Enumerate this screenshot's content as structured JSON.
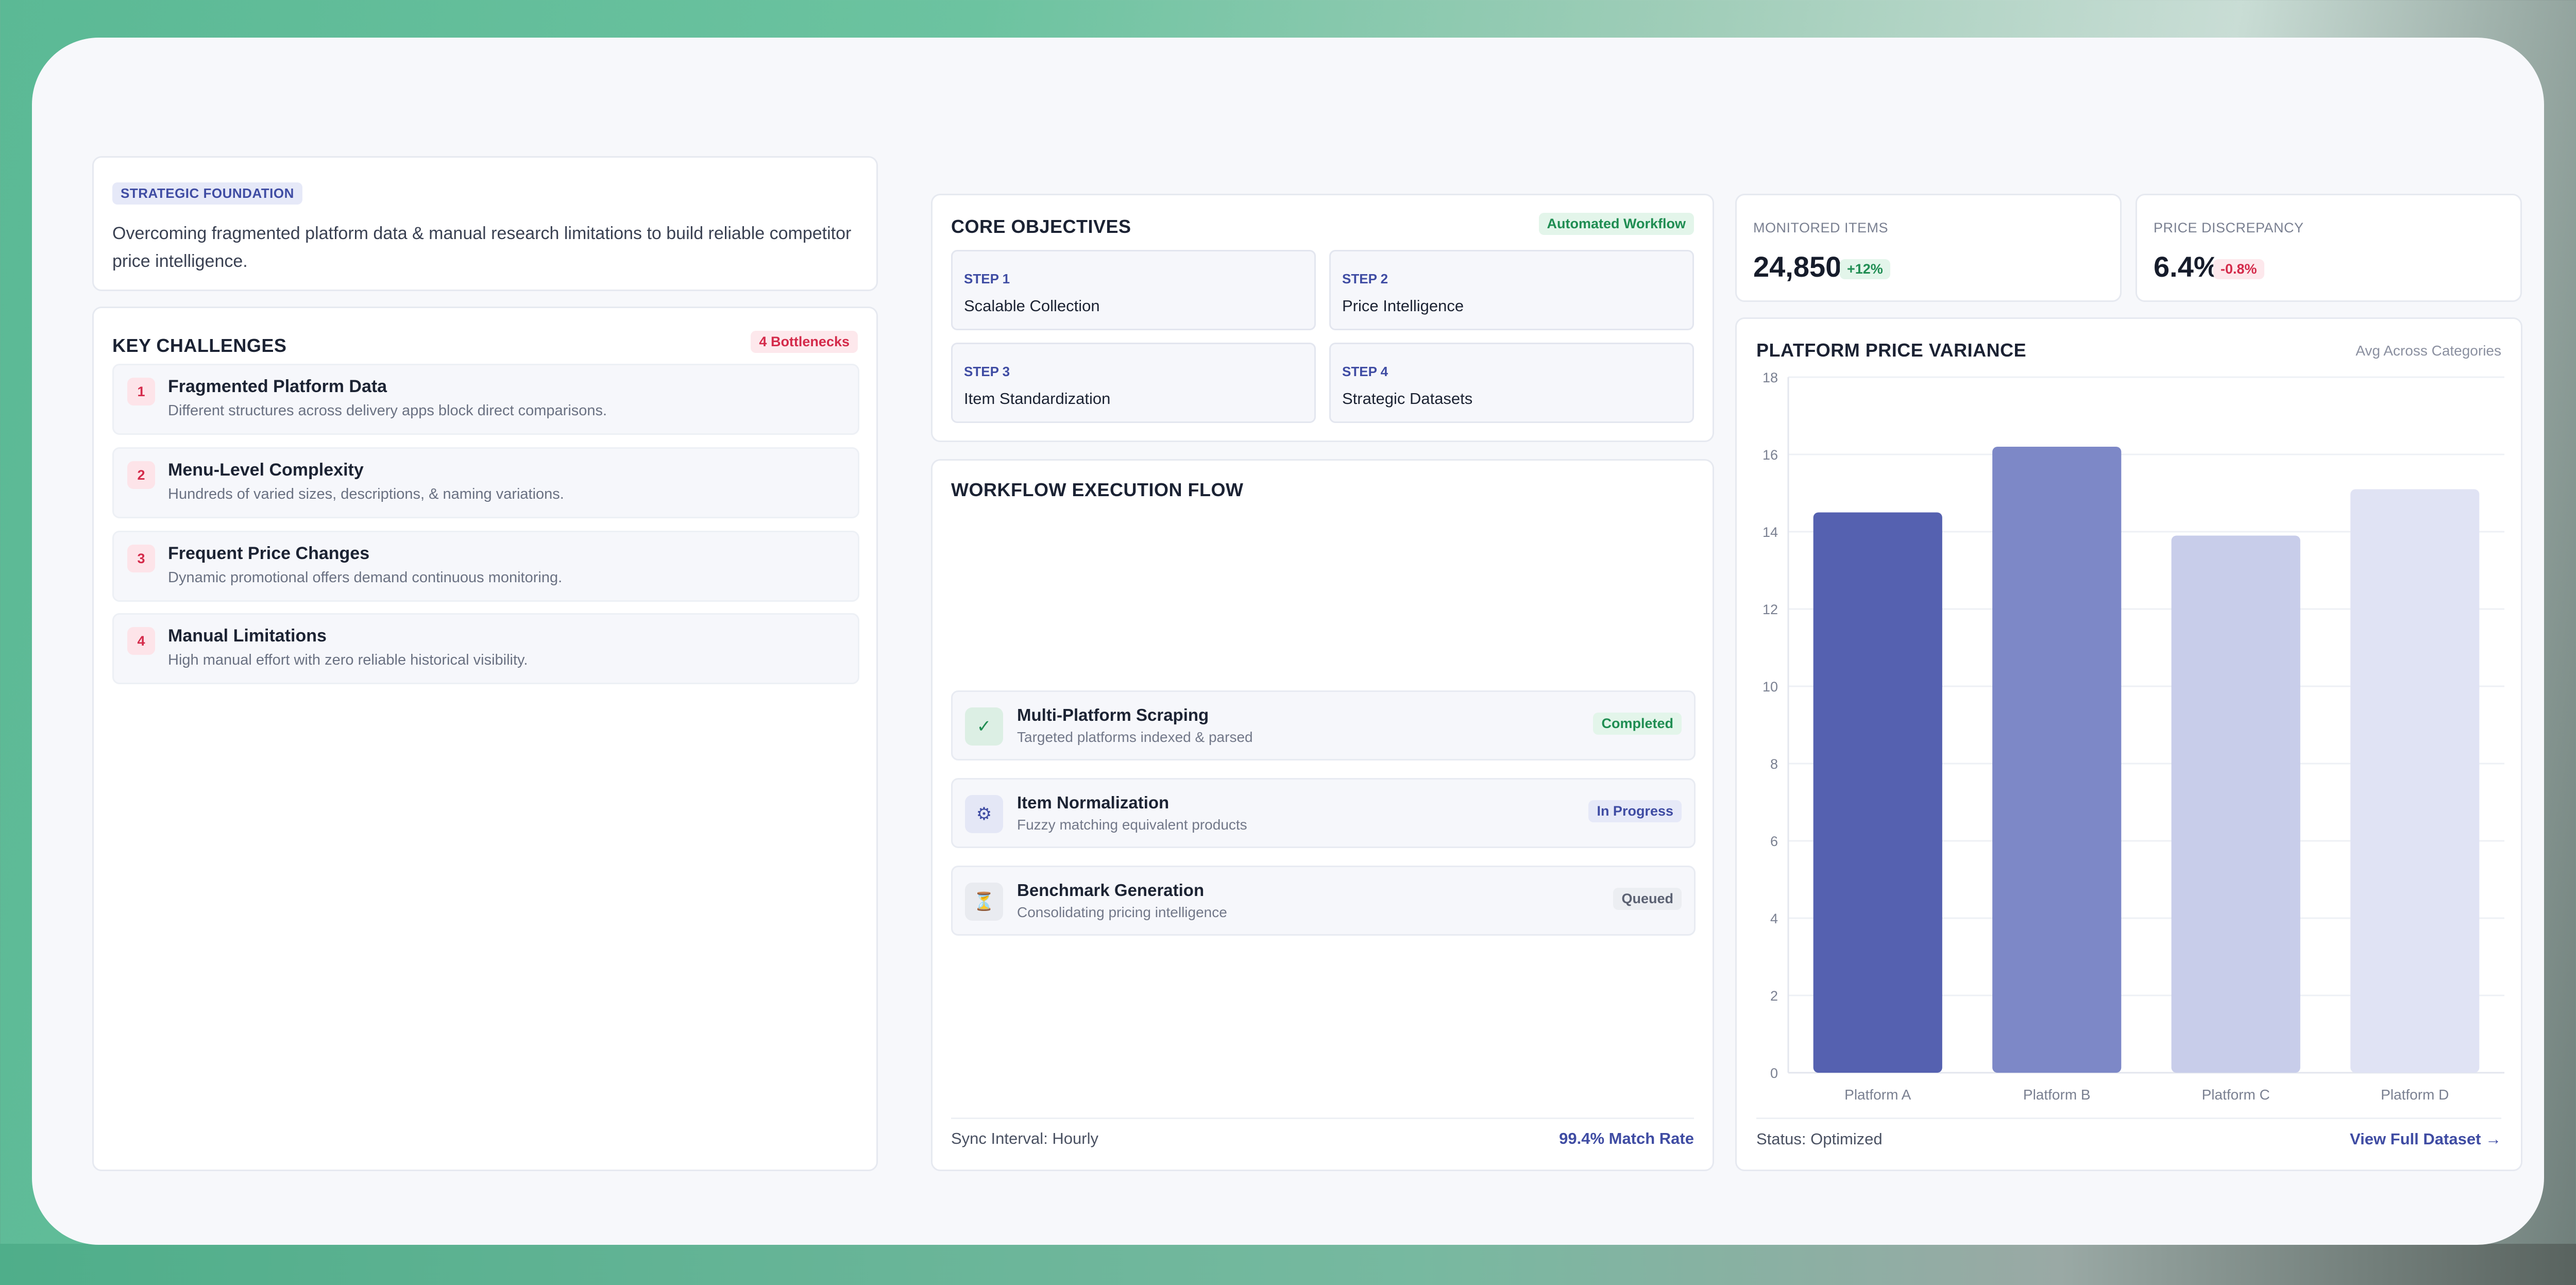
{
  "strategic_foundation": {
    "tag": "STRATEGIC FOUNDATION",
    "description": "Overcoming fragmented platform data & manual research limitations to build reliable competitor price intelligence."
  },
  "key_challenges": {
    "title": "KEY CHALLENGES",
    "badge": "4 Bottlenecks",
    "items": [
      {
        "num": "1",
        "title": "Fragmented Platform Data",
        "desc": "Different structures across delivery apps block direct comparisons."
      },
      {
        "num": "2",
        "title": "Menu-Level Complexity",
        "desc": "Hundreds of varied sizes, descriptions, & naming variations."
      },
      {
        "num": "3",
        "title": "Frequent Price Changes",
        "desc": "Dynamic promotional offers demand continuous monitoring."
      },
      {
        "num": "4",
        "title": "Manual Limitations",
        "desc": "High manual effort with zero reliable historical visibility."
      }
    ]
  },
  "core_objectives": {
    "title": "CORE OBJECTIVES",
    "badge": "Automated Workflow",
    "steps": [
      {
        "label": "STEP 1",
        "name": "Scalable Collection"
      },
      {
        "label": "STEP 2",
        "name": "Price Intelligence"
      },
      {
        "label": "STEP 3",
        "name": "Item Standardization"
      },
      {
        "label": "STEP 4",
        "name": "Strategic Datasets"
      }
    ]
  },
  "workflow": {
    "title": "WORKFLOW EXECUTION FLOW",
    "rows": [
      {
        "icon": "check-icon",
        "glyph": "✓",
        "title": "Multi-Platform Scraping",
        "desc": "Targeted platforms indexed & parsed",
        "status": "Completed"
      },
      {
        "icon": "gear-icon",
        "glyph": "⚙",
        "title": "Item Normalization",
        "desc": "Fuzzy matching equivalent products",
        "status": "In Progress"
      },
      {
        "icon": "hourglass-icon",
        "glyph": "⏳",
        "title": "Benchmark Generation",
        "desc": "Consolidating pricing intelligence",
        "status": "Queued"
      }
    ],
    "footer_left": "Sync Interval: Hourly",
    "footer_right": "99.4% Match Rate"
  },
  "metrics": {
    "monitored": {
      "label": "MONITORED ITEMS",
      "value": "24,850",
      "change": "+12%"
    },
    "discrepancy": {
      "label": "PRICE DISCREPANCY",
      "value": "6.4%",
      "change": "-0.8%"
    }
  },
  "chart_panel": {
    "title": "PLATFORM PRICE VARIANCE",
    "subtitle": "Avg Across Categories",
    "footer_left": "Status: Optimized",
    "footer_right": "View Full Dataset →"
  },
  "chart_data": {
    "type": "bar",
    "categories": [
      "Platform A",
      "Platform B",
      "Platform C",
      "Platform D"
    ],
    "values": [
      14.5,
      16.2,
      13.9,
      15.1
    ],
    "ylim": [
      0,
      18
    ],
    "yticks": [
      0,
      2,
      4,
      6,
      8,
      10,
      12,
      14,
      16,
      18
    ],
    "colors": [
      "#5561b0",
      "#7d88c7",
      "#c8cdea",
      "#e0e3f4"
    ],
    "grid": true
  },
  "colors": {
    "accent": "#3f4ca3",
    "success": "#1f8d52",
    "danger": "#d42a4a"
  }
}
